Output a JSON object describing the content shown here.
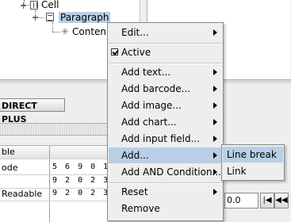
{
  "tree": {
    "cell_label": "Cell",
    "paragraph_label": "Paragraph",
    "content_label": "Conten"
  },
  "toolbar": {
    "direct_plus_label": "DIRECT PLUS"
  },
  "table": {
    "rows": [
      {
        "label": "ble",
        "value": ""
      },
      {
        "label": "ode",
        "value": "5 6 9 0 1"
      },
      {
        "label": "",
        "value": "9 2 0 2 3 9 0"
      },
      {
        "label": "Readable",
        "value": "9 2 0 2   3 9"
      }
    ]
  },
  "context_menu": {
    "items": [
      {
        "label": "Edit...",
        "submenu": true
      },
      {
        "label": "Active",
        "checked": true
      },
      {
        "label": "Add text...",
        "submenu": true
      },
      {
        "label": "Add barcode...",
        "submenu": true
      },
      {
        "label": "Add image...",
        "submenu": true
      },
      {
        "label": "Add chart...",
        "submenu": true
      },
      {
        "label": "Add input field...",
        "submenu": true
      },
      {
        "label": "Add...",
        "submenu": true,
        "highlighted": true
      },
      {
        "label": "Add AND Condition...",
        "submenu": true
      },
      {
        "label": "Reset",
        "submenu": true
      },
      {
        "label": "Remove",
        "submenu": false
      }
    ]
  },
  "submenu": {
    "items": [
      {
        "label": "Line break",
        "highlighted": true
      },
      {
        "label": "Link"
      }
    ]
  },
  "controls": {
    "spinner_value": "0.0",
    "prev_first_label": "|◀",
    "prev_label": "◀◀"
  },
  "colors": {
    "highlight": "#b8cfe5",
    "menu_bg": "#eeeeee"
  }
}
